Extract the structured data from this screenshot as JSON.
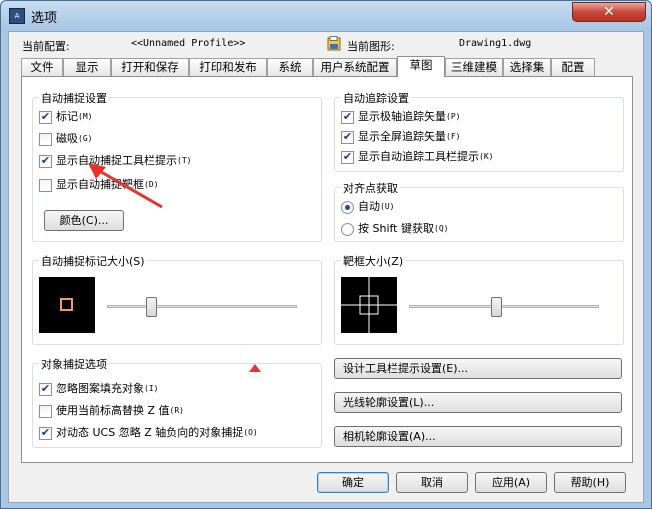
{
  "window": {
    "title": "选项",
    "app_icon_text": "A",
    "close_glyph": "✕"
  },
  "profile": {
    "label": "当前配置:",
    "value": "<<Unnamed Profile>>"
  },
  "drawing": {
    "label": "当前图形:",
    "value": "Drawing1.dwg"
  },
  "tabs": [
    {
      "label": "文件"
    },
    {
      "label": "显示"
    },
    {
      "label": "打开和保存"
    },
    {
      "label": "打印和发布"
    },
    {
      "label": "系统"
    },
    {
      "label": "用户系统配置"
    },
    {
      "label": "草图",
      "active": true
    },
    {
      "label": "三维建模"
    },
    {
      "label": "选择集"
    },
    {
      "label": "配置"
    }
  ],
  "autosnap": {
    "title": "自动捕捉设置",
    "items": [
      {
        "label": "标记",
        "shortcut": "(M)",
        "checked": true
      },
      {
        "label": "磁吸",
        "shortcut": "(G)",
        "checked": false
      },
      {
        "label": "显示自动捕捉工具栏提示",
        "shortcut": "(T)",
        "checked": true
      },
      {
        "label": "显示自动捕捉靶框",
        "shortcut": "(D)",
        "checked": false
      }
    ],
    "color_button": "颜色(C)..."
  },
  "autotrack": {
    "title": "自动追踪设置",
    "items": [
      {
        "label": "显示极轴追踪矢量",
        "shortcut": "(P)",
        "checked": true
      },
      {
        "label": "显示全屏追踪矢量",
        "shortcut": "(F)",
        "checked": true
      },
      {
        "label": "显示自动追踪工具栏提示",
        "shortcut": "(K)",
        "checked": true
      }
    ]
  },
  "alignment": {
    "title": "对齐点获取",
    "options": [
      {
        "label": "自动",
        "shortcut": "(U)",
        "selected": true
      },
      {
        "label": "按 Shift 键获取",
        "shortcut": "(Q)",
        "selected": false
      }
    ]
  },
  "marker_size": {
    "title": "自动捕捉标记大小(S)",
    "level": 0.22,
    "marker_color": "#f39a5e"
  },
  "aperture_size": {
    "title": "靶框大小(Z)",
    "level": 0.46
  },
  "object_snap": {
    "title": "对象捕捉选项",
    "items": [
      {
        "label": "忽略图案填充对象",
        "shortcut": "(I)",
        "checked": true
      },
      {
        "label": "使用当前标高替换 Z 值",
        "shortcut": "(R)",
        "checked": false
      },
      {
        "label": "对动态 UCS 忽略 Z 轴负向的对象捕捉",
        "shortcut": "(O)",
        "checked": true
      }
    ]
  },
  "side_buttons": [
    {
      "label": "设计工具栏提示设置(E)..."
    },
    {
      "label": "光线轮廓设置(L)..."
    },
    {
      "label": "相机轮廓设置(A)..."
    }
  ],
  "footer_buttons": [
    {
      "label": "确定",
      "default": true
    },
    {
      "label": "取消"
    },
    {
      "label": "应用(A)"
    },
    {
      "label": "帮助(H)"
    }
  ],
  "annotation": {
    "arrow_color": "#e8322a"
  }
}
